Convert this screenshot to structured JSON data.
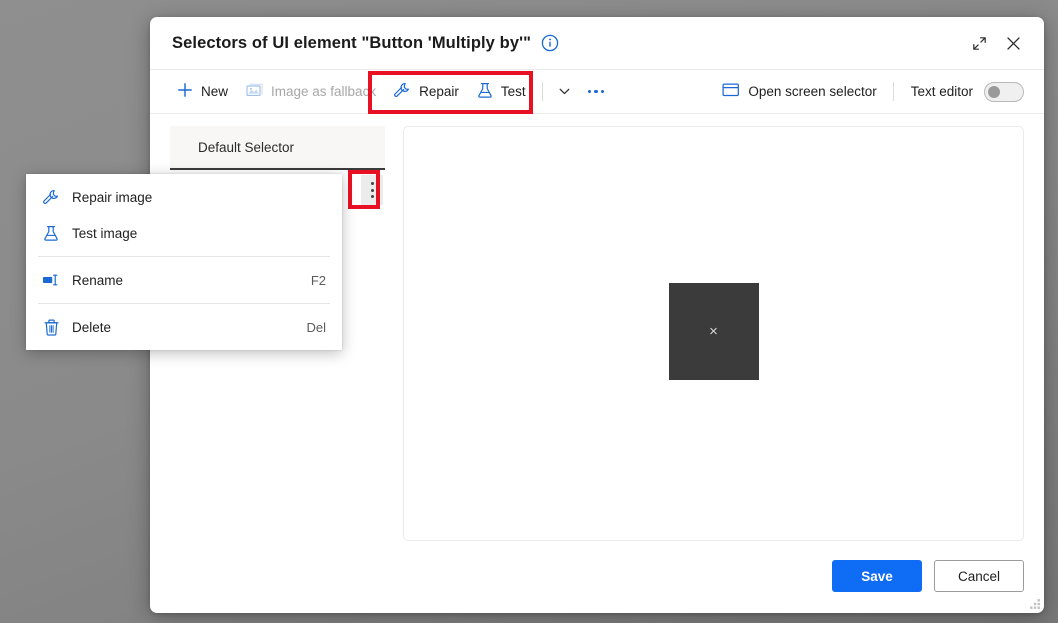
{
  "window": {
    "title": "Selectors of UI element \"Button 'Multiply by'\"",
    "info_icon": "info-circle-icon",
    "expand_icon": "expand-icon",
    "close_icon": "close-icon"
  },
  "toolbar": {
    "new_label": "New",
    "new_icon": "plus-icon",
    "image_fallback_label": "Image as fallback",
    "image_fallback_icon": "image-icon",
    "repair_label": "Repair",
    "repair_icon": "wrench-icon",
    "test_label": "Test",
    "test_icon": "flask-icon",
    "chevron_icon": "chevron-down-icon",
    "overflow_icon": "ellipsis-icon",
    "open_screen_selector_label": "Open screen selector",
    "open_screen_selector_icon": "window-icon",
    "text_editor_label": "Text editor",
    "text_editor_state": "off"
  },
  "selectors": {
    "tab_label": "Default Selector",
    "kebab_icon": "more-options-icon",
    "row_label": ""
  },
  "preview": {
    "placeholder_glyph": "×"
  },
  "context_menu": {
    "items": [
      {
        "label": "Repair image",
        "icon": "wrench-icon",
        "shortcut": ""
      },
      {
        "label": "Test image",
        "icon": "flask-icon",
        "shortcut": ""
      },
      {
        "label": "Rename",
        "icon": "rename-icon",
        "shortcut": "F2"
      },
      {
        "label": "Delete",
        "icon": "trash-icon",
        "shortcut": "Del"
      }
    ]
  },
  "footer": {
    "save_label": "Save",
    "cancel_label": "Cancel"
  },
  "colors": {
    "accent_blue": "#0f6cf5",
    "icon_blue": "#1a6ad4",
    "highlight_red": "#e81123",
    "preview_dark": "#3b3b3b"
  }
}
